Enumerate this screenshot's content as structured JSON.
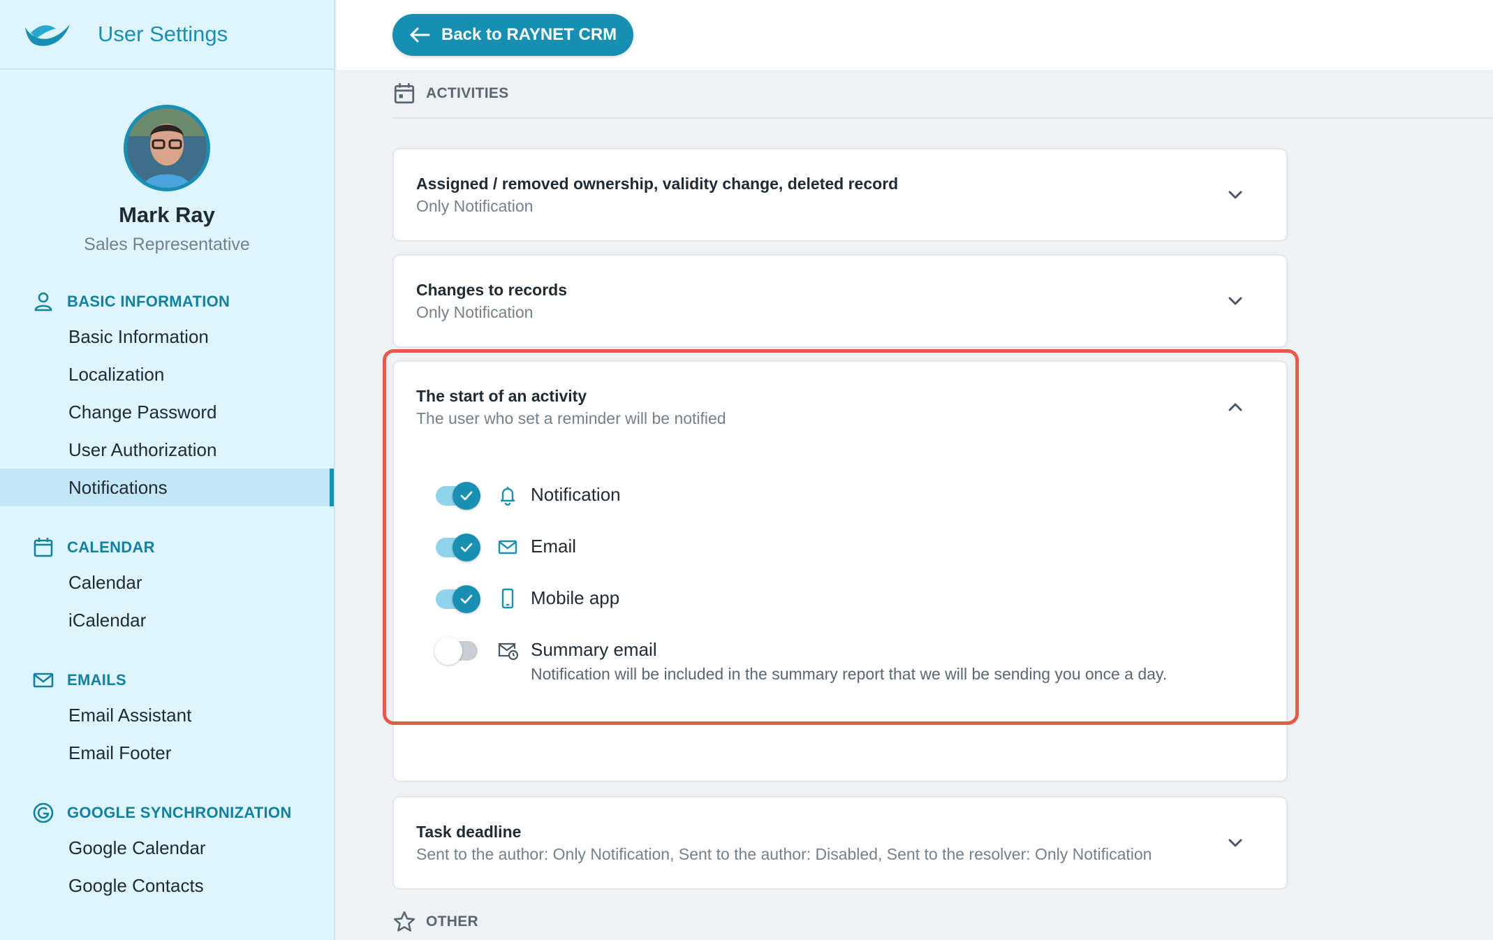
{
  "app": {
    "title": "User Settings"
  },
  "profile": {
    "name": "Mark Ray",
    "role": "Sales Representative"
  },
  "sidebar": {
    "sections": [
      {
        "title": "BASIC INFORMATION",
        "icon": "person-icon",
        "items": [
          {
            "label": "Basic Information"
          },
          {
            "label": "Localization"
          },
          {
            "label": "Change Password"
          },
          {
            "label": "User Authorization"
          },
          {
            "label": "Notifications",
            "active": true
          }
        ]
      },
      {
        "title": "CALENDAR",
        "icon": "calendar-icon",
        "items": [
          {
            "label": "Calendar"
          },
          {
            "label": "iCalendar"
          }
        ]
      },
      {
        "title": "EMAILS",
        "icon": "mail-icon",
        "items": [
          {
            "label": "Email Assistant"
          },
          {
            "label": "Email Footer"
          }
        ]
      },
      {
        "title": "GOOGLE SYNCHRONIZATION",
        "icon": "google-icon",
        "items": [
          {
            "label": "Google Calendar"
          },
          {
            "label": "Google Contacts"
          }
        ]
      }
    ]
  },
  "topbar": {
    "back_label": "Back to RAYNET CRM"
  },
  "main": {
    "activities_heading": "ACTIVITIES",
    "other_heading": "OTHER",
    "cards": [
      {
        "title": "Assigned / removed ownership, validity change, deleted record",
        "subtitle": "Only Notification"
      },
      {
        "title": "Changes to records",
        "subtitle": "Only Notification"
      },
      {
        "title": "The start of an activity",
        "subtitle": "The user who set a reminder will be notified",
        "options": [
          {
            "label": "Notification",
            "icon": "bell-icon",
            "enabled": true
          },
          {
            "label": "Email",
            "icon": "mail-icon",
            "enabled": true
          },
          {
            "label": "Mobile app",
            "icon": "phone-icon",
            "enabled": true
          },
          {
            "label": "Summary email",
            "icon": "summary-mail-icon",
            "enabled": false,
            "description": "Notification will be included in the summary report that we will be sending you once a day."
          }
        ]
      },
      {
        "title": "Task deadline",
        "subtitle": "Sent to the author: Only Notification, Sent to the author: Disabled, Sent to the resolver: Only Notification"
      }
    ]
  },
  "colors": {
    "accent": "#1a8fb4",
    "highlight": "#e8594a",
    "sidebar_bg": "#def5fd"
  }
}
